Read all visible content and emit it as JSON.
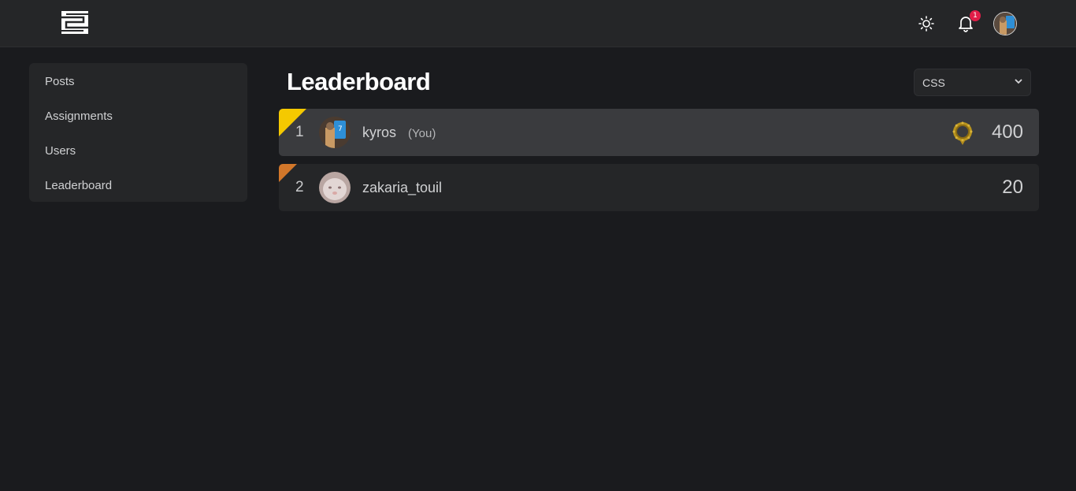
{
  "header": {
    "logo_icon": "app-logo",
    "theme_icon": "sun-icon",
    "notification_icon": "bell-icon",
    "notification_count": "1",
    "avatar_icon": "user-avatar"
  },
  "sidebar": {
    "items": [
      {
        "label": "Posts"
      },
      {
        "label": "Assignments"
      },
      {
        "label": "Users"
      },
      {
        "label": "Leaderboard"
      }
    ]
  },
  "main": {
    "title": "Leaderboard",
    "language_select": {
      "selected": "CSS"
    }
  },
  "leaderboard": [
    {
      "rank": "1",
      "username": "kyros",
      "you_label": "(You)",
      "score": "400",
      "badge_icon": "gold-medal-icon",
      "accent": "#f5c900"
    },
    {
      "rank": "2",
      "username": "zakaria_touil",
      "score": "20",
      "accent": "#d2772a"
    }
  ],
  "colors": {
    "background": "#1a1b1e",
    "panel": "#252628",
    "highlight_row": "#3a3b3e",
    "notification": "#e11d48"
  }
}
